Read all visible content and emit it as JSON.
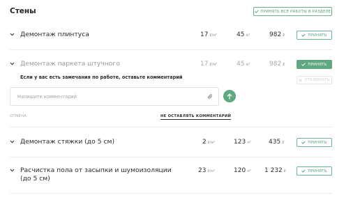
{
  "section": {
    "title": "Стены",
    "accept_all_label": "Принять все работы в разделе"
  },
  "rows": [
    {
      "title": "Демонтаж плинтуса",
      "qty": "17",
      "qty_unit": "₽/м²",
      "area": "45",
      "area_unit": "м²",
      "total": "982",
      "total_unit": "₽",
      "accept_label": "Принять"
    },
    {
      "title": "Демонтаж паркета штучного",
      "qty": "17",
      "qty_unit": "₽/м²",
      "area": "45",
      "area_unit": "м²",
      "total": "982",
      "total_unit": "₽",
      "accept_label": "Принять",
      "reject_label": "Отклонить",
      "expanded": true
    },
    {
      "title": "Демонтаж стяжки (до 5 см)",
      "qty": "2",
      "qty_unit": "₽/м²",
      "area": "123",
      "area_unit": "м²",
      "total": "435",
      "total_unit": "₽",
      "accept_label": "Принять"
    },
    {
      "title_line1": "Расчистка пола от засыпки и шумоизоляции",
      "title_line2": "(до 5 см)",
      "qty": "23",
      "qty_unit": "₽/м²",
      "area": "120",
      "area_unit": "м²",
      "total": "1 232",
      "total_unit": "₽",
      "accept_label": "Принять"
    }
  ],
  "comment": {
    "prompt": "Если у вас есть замечания по работе, оставьте комментарий",
    "placeholder": "Напишите комментарий",
    "value": "",
    "cancel_label": "Отмена",
    "no_comment_label": "Не оставлять комментарий"
  },
  "colors": {
    "accent": "#5fa882",
    "accent_text": "#4e9d73",
    "muted": "#a8a8a8"
  },
  "icons": {
    "chevron": "chevron-down-icon",
    "check": "check-icon",
    "close": "close-icon",
    "attach": "paperclip-icon",
    "send": "arrow-up-icon"
  }
}
